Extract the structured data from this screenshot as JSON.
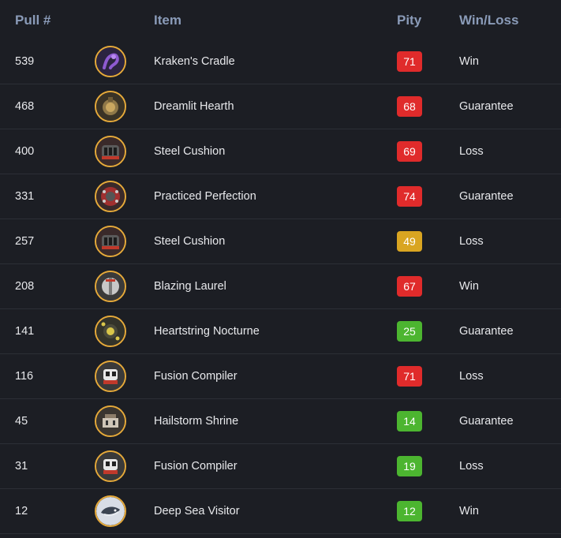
{
  "headers": {
    "pull": "Pull #",
    "item": "Item",
    "pity": "Pity",
    "winloss": "Win/Loss"
  },
  "colors": {
    "red": "#e02b2b",
    "yellow": "#d9a521",
    "green": "#4cb530",
    "icon_border": "#e5a93a"
  },
  "rows": [
    {
      "pull": "539",
      "item": "Kraken's Cradle",
      "icon": "kraken-icon",
      "pity": "71",
      "pity_color": "red",
      "result": "Win"
    },
    {
      "pull": "468",
      "item": "Dreamlit Hearth",
      "icon": "hearth-icon",
      "pity": "68",
      "pity_color": "red",
      "result": "Guarantee"
    },
    {
      "pull": "400",
      "item": "Steel Cushion",
      "icon": "cushion-icon",
      "pity": "69",
      "pity_color": "red",
      "result": "Loss"
    },
    {
      "pull": "331",
      "item": "Practiced Perfection",
      "icon": "perfection-icon",
      "pity": "74",
      "pity_color": "red",
      "result": "Guarantee"
    },
    {
      "pull": "257",
      "item": "Steel Cushion",
      "icon": "cushion-icon",
      "pity": "49",
      "pity_color": "yellow",
      "result": "Loss"
    },
    {
      "pull": "208",
      "item": "Blazing Laurel",
      "icon": "laurel-icon",
      "pity": "67",
      "pity_color": "red",
      "result": "Win"
    },
    {
      "pull": "141",
      "item": "Heartstring Nocturne",
      "icon": "nocturne-icon",
      "pity": "25",
      "pity_color": "green",
      "result": "Guarantee"
    },
    {
      "pull": "116",
      "item": "Fusion Compiler",
      "icon": "compiler-icon",
      "pity": "71",
      "pity_color": "red",
      "result": "Loss"
    },
    {
      "pull": "45",
      "item": "Hailstorm Shrine",
      "icon": "shrine-icon",
      "pity": "14",
      "pity_color": "green",
      "result": "Guarantee"
    },
    {
      "pull": "31",
      "item": "Fusion Compiler",
      "icon": "compiler-icon",
      "pity": "19",
      "pity_color": "green",
      "result": "Loss"
    },
    {
      "pull": "12",
      "item": "Deep Sea Visitor",
      "icon": "deepsea-icon",
      "pity": "12",
      "pity_color": "green",
      "result": "Win"
    }
  ]
}
